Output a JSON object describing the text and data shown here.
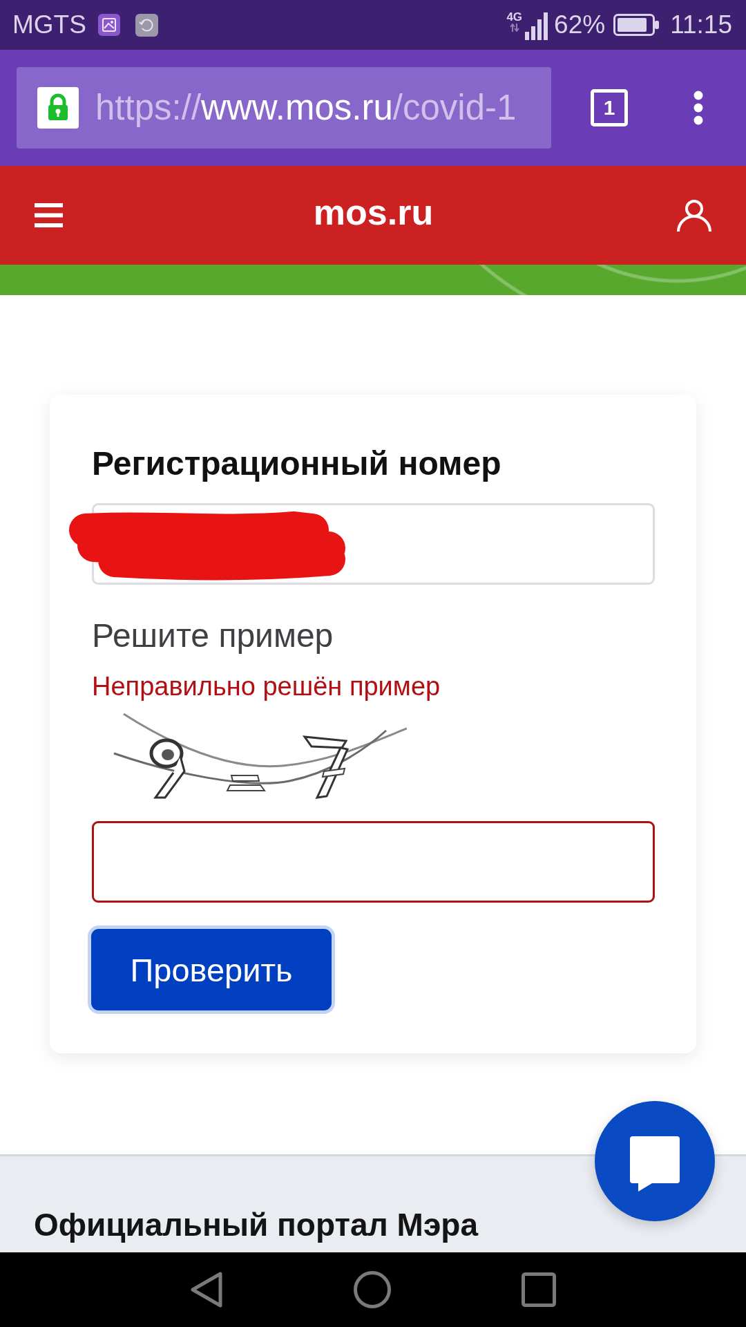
{
  "status_bar": {
    "carrier": "MGTS",
    "network": "4G",
    "battery": "62%",
    "time": "11:15"
  },
  "browser": {
    "secure": true,
    "url": {
      "scheme": "https://",
      "host": "www.mos.ru",
      "path": "/covid-1"
    },
    "tab_count": "1"
  },
  "header": {
    "logo": "mos.ru"
  },
  "form": {
    "fields": [
      {
        "kind": "text",
        "label": "Регистрационный номер",
        "redacted": true,
        "error": false
      },
      {
        "kind": "captcha",
        "label": "Решите пример",
        "error_message": "Неправильно решён пример",
        "error": true
      }
    ],
    "submit": {
      "label": "Проверить",
      "focused": true
    }
  },
  "footer": {
    "title": "Официальный портал Мэра"
  }
}
